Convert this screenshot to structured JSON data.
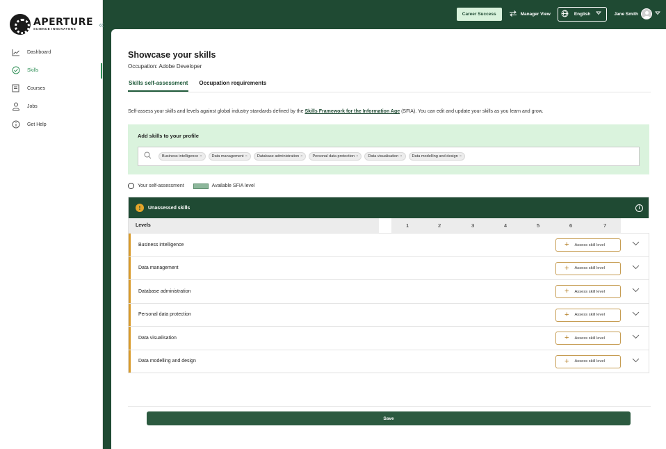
{
  "brand": {
    "title": "APERTURE",
    "subtitle": "SCIENCE INNOVATORS"
  },
  "sidebar": {
    "items": [
      {
        "label": "Dashboard",
        "icon": "chart-line-icon",
        "active": false
      },
      {
        "label": "Skills",
        "icon": "check-circle-icon",
        "active": true
      },
      {
        "label": "Courses",
        "icon": "book-icon",
        "active": false
      },
      {
        "label": "Jobs",
        "icon": "person-icon",
        "active": false
      },
      {
        "label": "Get Help",
        "icon": "info-circle-icon",
        "active": false
      }
    ]
  },
  "topbar": {
    "career_success": "Career Success",
    "manager_view": "Manager View",
    "language": "English",
    "user_name": "Jane Smith"
  },
  "page": {
    "title": "Showcase your skills",
    "occupation": "Occupation: Adobe Developer",
    "tabs": [
      {
        "label": "Skills self-assessment",
        "active": true
      },
      {
        "label": "Occupation requirements",
        "active": false
      }
    ],
    "description_prefix": "Self-assess your skills and levels against global industry standards defined by the ",
    "description_link": "Skills Framework for the Information Age",
    "description_suffix": " (SFIA). You can edit and update your skills as you learn and grow."
  },
  "add_skills": {
    "title": "Add skills to your profile",
    "chips": [
      "Business intelligence",
      "Data management",
      "Database administration",
      "Personal data protection",
      "Data visualisation",
      "Data modelling and design"
    ]
  },
  "legend": {
    "self_assessment": "Your self-assessment",
    "available": "Available SFIA level"
  },
  "table": {
    "header": "Unassessed skills",
    "levels_label": "Levels",
    "levels": [
      "1",
      "2",
      "3",
      "4",
      "5",
      "6",
      "7"
    ],
    "assess_label": "Assess skill level",
    "rows": [
      "Business intelligence",
      "Data management",
      "Database administration",
      "Personal data protection",
      "Data visualisation",
      "Data modelling and design"
    ]
  },
  "save_label": "Save",
  "colors": {
    "brand_green": "#1f4a33",
    "accent_light": "#daf3dd",
    "warning_gold": "#d89a2a"
  }
}
